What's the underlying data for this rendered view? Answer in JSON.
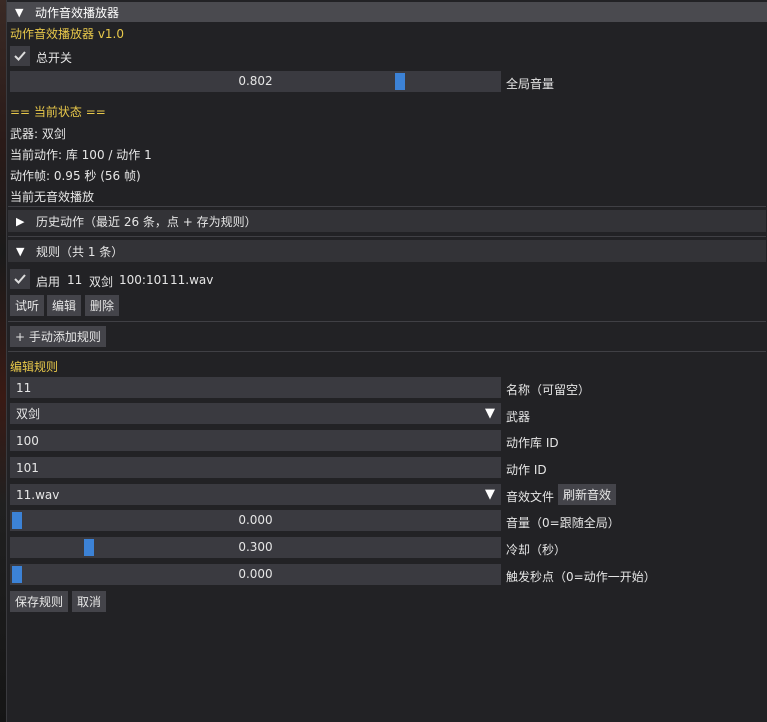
{
  "window": {
    "title": "动作音效播放器"
  },
  "app": {
    "version_title": "动作音效播放器 v1.0"
  },
  "master": {
    "toggle_label": "总开关",
    "volume_value": "0.802",
    "volume_label": "全局音量",
    "volume_level": 0.802
  },
  "status": {
    "heading": "== 当前状态 ==",
    "weapon": "武器: 双剑",
    "action": "当前动作: 库 100 / 动作 1",
    "frame": "动作帧: 0.95 秒 (56 帧)",
    "sound": "当前无音效播放"
  },
  "history": {
    "header": "历史动作（最近 26 条，点 + 存为规则）"
  },
  "rules": {
    "header": "规则（共 1 条）",
    "items": [
      {
        "enabled_label": "启用",
        "name": "11",
        "weapon": "双剑",
        "ids": "100:101",
        "file": "11.wav"
      }
    ],
    "listen_button": "试听",
    "edit_button": "编辑",
    "delete_button": "删除",
    "add_button": "+ 手动添加规则"
  },
  "editor": {
    "heading": "编辑规则",
    "name_value": "11",
    "name_label": "名称（可留空）",
    "weapon_value": "双剑",
    "weapon_label": "武器",
    "library_value": "100",
    "library_label": "动作库 ID",
    "action_value": "101",
    "action_label": "动作 ID",
    "file_value": "11.wav",
    "file_label": "音效文件",
    "refresh_button": "刷新音效",
    "volume_value": "0.000",
    "volume_label": "音量（0=跟随全局）",
    "volume_level": 0.0,
    "cooldown_value": "0.300",
    "cooldown_label": "冷却（秒）",
    "cooldown_level": 0.15,
    "trigger_value": "0.000",
    "trigger_label": "触发秒点（0=动作一开始）",
    "trigger_level": 0.0,
    "save_button": "保存规则",
    "cancel_button": "取消"
  },
  "colors": {
    "accent": "#3c82d6",
    "heading": "#e8c84a",
    "titlebar": "#4a4a4f"
  }
}
